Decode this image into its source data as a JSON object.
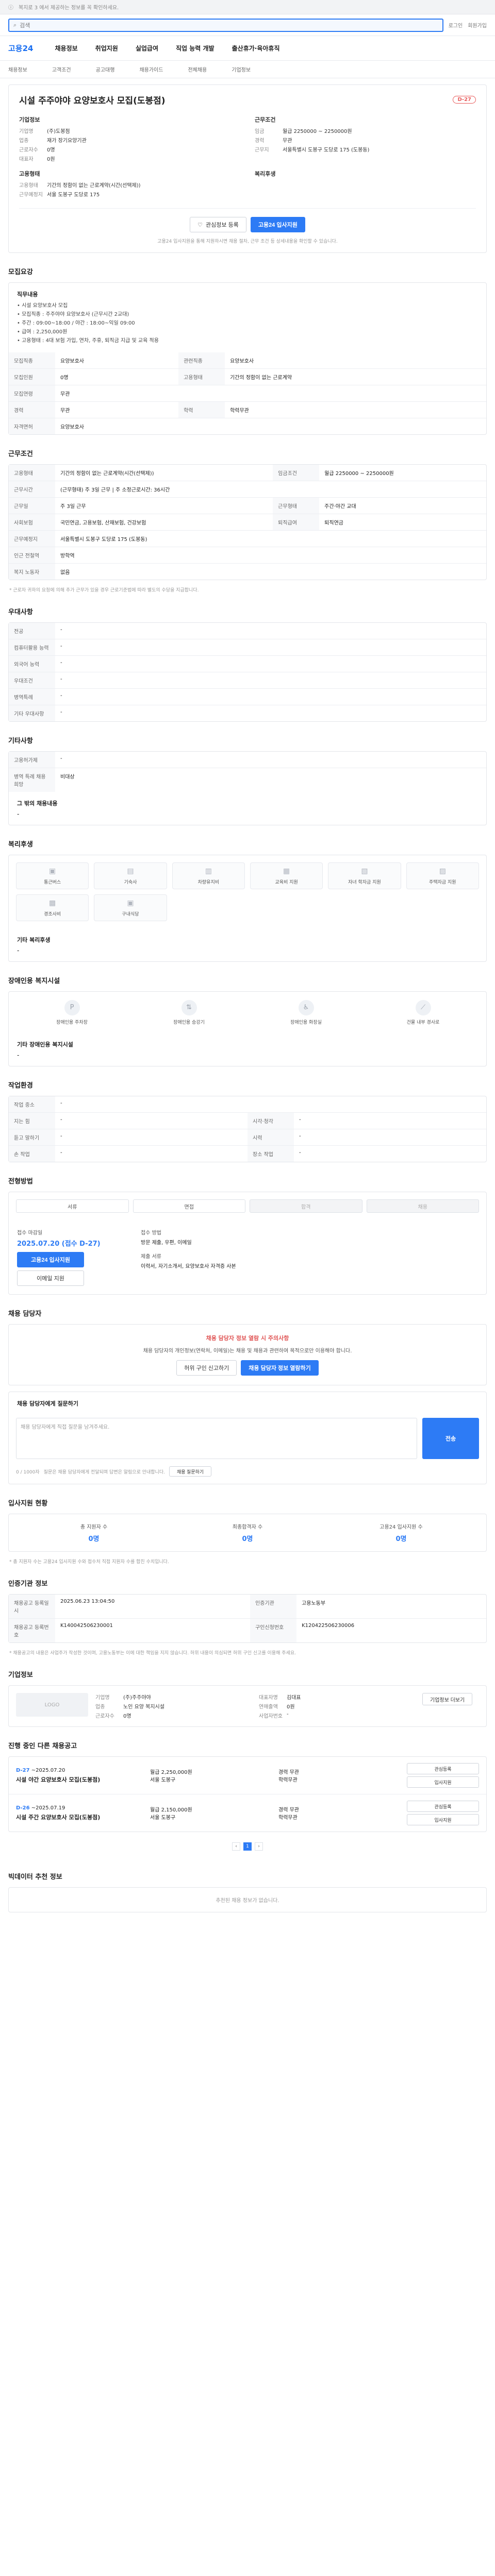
{
  "top_notice": "복지로 3 에서 제공하는 정보를 꼭 확인하세요.",
  "header": {
    "logo": "고용24",
    "search_placeholder": "검색",
    "links": [
      "로그인",
      "회원가입"
    ]
  },
  "gnb": [
    "채용정보",
    "취업지원",
    "실업급여",
    "직업 능력 개발",
    "출산휴가·육아휴직"
  ],
  "subnav": [
    "채용정보",
    "고객조건",
    "공고대행",
    "채용가이드",
    "전체채용",
    "기업정보"
  ],
  "job": {
    "title": "시설 주주야야 요양보호사 모집(도봉점)",
    "dday": "D-27",
    "company_header": "기업정보",
    "company_rows": [
      [
        "기업명",
        "(주)도봉점"
      ],
      [
        "업종",
        "재가 장기요양기관"
      ],
      [
        "근로자수",
        "0명"
      ],
      [
        "대표자",
        "0원"
      ]
    ],
    "cond_header": "근무조건",
    "cond_rows": [
      [
        "임금",
        "월급 2250000 ~ 2250000원"
      ],
      [
        "경력",
        "무관"
      ],
      [
        "근무지",
        "서울특별시 도봉구 도당로 175 (도봉동)"
      ]
    ],
    "manager_header": "고용형태",
    "manager_rows": [
      [
        "고용형태",
        "기간의 정함이 없는 근로계약(시간(선택제))"
      ],
      [
        "근무예정지",
        "서울 도봉구 도당로 175"
      ]
    ],
    "welfare_header": "복리후생",
    "btn_scrap": "관심정보 등록",
    "btn_apply": "고용24 입사지원",
    "hero_note": "고용24 입사지원을 통해 지원하시면 채용 절차, 근무 조건 등 상세내용을 확인할 수 있습니다."
  },
  "detail": {
    "title": "모집요강",
    "duty_header": "직무내용",
    "duty_list": [
      "• 시설 요양보호사 모집",
      "• 모집직종 : 주주야야 요양보호사 (근무시간 2교대)",
      "• 주간 : 09:00~18:00 / 야간 : 18:00~익일 09:00",
      "• 급여 : 2,250,000원",
      "• 고용형태 : 4대 보험 가입, 연차, 주휴, 퇴직금 지급 및 교육 적용"
    ],
    "rows": [
      [
        [
          "모집직종",
          "요양보호사"
        ],
        [
          "관련직종",
          "요양보호사"
        ]
      ],
      [
        [
          "모집인원",
          "0명"
        ],
        [
          "고용형태",
          "기간의 정함이 없는 근로계약"
        ]
      ],
      [
        [
          "모집연령",
          "무관"
        ],
        [
          "",
          ""
        ]
      ],
      [
        [
          "경력",
          "무관"
        ],
        [
          "학력",
          "학력무관"
        ]
      ],
      [
        [
          "자격면허",
          "요양보호사"
        ],
        [
          "",
          ""
        ]
      ]
    ]
  },
  "work": {
    "title": "근무조건",
    "rows": [
      [
        [
          "고용형태",
          "기간의 정함이 없는 근로계약(시간(선택제))"
        ],
        [
          "임금조건",
          "월급 2250000 ~ 2250000원"
        ]
      ],
      [
        [
          "근무시간",
          "(근무형태) 주 3일 근무 | 주 소정근로시간: 36시간"
        ],
        [
          "",
          ""
        ]
      ],
      [
        [
          "근무일",
          "주 3일 근무"
        ],
        [
          "근무형태",
          "주간·야간 교대"
        ]
      ],
      [
        [
          "사회보험",
          "국민연금, 고용보험, 산재보험, 건강보험"
        ],
        [
          "퇴직급여",
          "퇴직연금"
        ]
      ],
      [
        [
          "근무예정지",
          "서울특별시 도봉구 도당로 175 (도봉동)"
        ],
        [
          "",
          ""
        ]
      ],
      [
        [
          "인근 전철역",
          "방학역"
        ],
        [
          "",
          ""
        ]
      ],
      [
        [
          "복지 노동자",
          "없음"
        ],
        [
          "",
          ""
        ]
      ]
    ],
    "footnote": "* 근로자 귀하의 요청에 의해 추가 근무가 있을 경우 근로기준법에 따라 별도의 수당을 지급합니다."
  },
  "pref": {
    "title": "우대사항",
    "rows": [
      [
        "전공",
        "-"
      ],
      [
        "컴퓨터활용 능력",
        "-"
      ],
      [
        "외국어 능력",
        "-"
      ],
      [
        "우대조건",
        "-"
      ],
      [
        "병역특례",
        "-"
      ],
      [
        "기타 우대사항",
        "-"
      ]
    ]
  },
  "etc": {
    "title": "기타사항",
    "rows": [
      [
        "고용허가제",
        "-"
      ],
      [
        "병역 특례 채용희망",
        "비대상"
      ]
    ],
    "extra_label": "그 밖의 채용내용",
    "extra_value": "-"
  },
  "welfare": {
    "title": "복리후생",
    "items": [
      "통근버스",
      "기숙사",
      "차량유지비",
      "교육비 지원",
      "자녀 학자금 지원",
      "주택자금 지원",
      "경조사비",
      "구내식당"
    ],
    "other_label": "기타 복리후생",
    "other_value": "-"
  },
  "disability": {
    "title": "장애인용 복지시설",
    "items": [
      "장애인용 주차장",
      "장애인용 승강기",
      "장애인용 화장실",
      "건물 내부 경사로"
    ],
    "other_label": "기타 장애인용 복지시설",
    "other_value": "-"
  },
  "env": {
    "title": "작업환경",
    "rows": [
      [
        [
          "작업 중소",
          "-"
        ],
        [
          "",
          ""
        ]
      ],
      [
        [
          "지는 힘",
          "-"
        ],
        [
          "시각·청각",
          "-"
        ]
      ],
      [
        [
          "듣고 말하기",
          "-"
        ],
        [
          "시력",
          "-"
        ]
      ],
      [
        [
          "손 작업",
          "-"
        ],
        [
          "장소 작업",
          "-"
        ]
      ]
    ]
  },
  "process": {
    "title": "전형방법",
    "steps": [
      "서류",
      "면접",
      "합격",
      "채용"
    ]
  },
  "apply": {
    "period_label": "접수 마감일",
    "period_value": "2025.07.20 (접수 D-27)",
    "btn_apply": "고용24 입사지원",
    "btn_email": "이메일 지원",
    "method_label": "접수 방법",
    "method_value": "방문 제출, 우편, 이메일",
    "docs_label": "제출 서류",
    "docs_value": "이력서, 자기소개서, 요양보호사 자격증 사본"
  },
  "contact": {
    "title": "채용 담당자",
    "alert_title": "채용 담당자 정보 열람 시 주의사항",
    "alert_body": "채용 담당자의 개인정보(연락처, 이메일)는 채용 및 채용과 관련하여 목적으로만 이용해야 합니다.",
    "btn_view": "채용 담당자 정보 열람하기",
    "btn_report": "허위 구인 신고하기"
  },
  "qna": {
    "title": "채용 담당자에게 질문하기",
    "placeholder": "채용 담당자에게 직접 질문을 남겨주세요.",
    "btn_ask": "전송",
    "counter": "0 / 1000자",
    "notice": "질문은 채용 담당자에게 전달되며 답변은 알림으로 안내합니다.",
    "btn_list": "채용 질문하기"
  },
  "stats": {
    "title": "입사지원 현황",
    "items": [
      [
        "총 지원자 수",
        "0명"
      ],
      [
        "최종합격자 수",
        "0명"
      ],
      [
        "고용24 입사지원 수",
        "0명"
      ]
    ],
    "note": "* 총 지원자 수는 고용24 입사지원 수와 접수처 직접 지원자 수를 합친 수치입니다."
  },
  "meta": {
    "title": "인증기관 정보",
    "rows": [
      [
        [
          "채용공고 등록일시",
          "2025.06.23 13:04:50"
        ],
        [
          "인증기관",
          "고용노동부"
        ]
      ],
      [
        [
          "채용공고 등록번호",
          "K140042506230001"
        ],
        [
          "구인신청번호",
          "K120422506230006"
        ]
      ]
    ],
    "footnote": "* 채용공고의 내용은 사업주가 작성한 것이며, 고용노동부는 이에 대한 책임을 지지 않습니다. 허위 내용이 의심되면 허위 구인 신고를 이용해 주세요."
  },
  "company": {
    "title": "기업정보",
    "logo": "LOGO",
    "rows1": [
      [
        "기업명",
        "(주)주주야야"
      ],
      [
        "업종",
        "노인 요양 복지시설"
      ],
      [
        "근로자수",
        "0명"
      ]
    ],
    "rows2": [
      [
        "대표자명",
        "김대표"
      ],
      [
        "연매출액",
        "0원"
      ],
      [
        "사업자번호",
        "-"
      ]
    ],
    "btn_detail": "기업정보 더보기"
  },
  "others": {
    "title": "진행 중인 다른 채용공고",
    "jobs": [
      {
        "dday": "D-27",
        "date": "~2025.07.20",
        "title": "시설 야간 요양보호사 모집(도봉점)",
        "cond1": "월급 2,250,000원",
        "cond2": "서울 도봉구",
        "cond3": "경력 무관",
        "cond4": "학력무관"
      },
      {
        "dday": "D-26",
        "date": "~2025.07.19",
        "title": "시설 주간 요양보호사 모집(도봉점)",
        "cond1": "월급 2,150,000원",
        "cond2": "서울 도봉구",
        "cond3": "경력 무관",
        "cond4": "학력무관"
      }
    ],
    "btn_scrap": "관심등록",
    "btn_apply": "입사지원",
    "pages": [
      "1"
    ]
  },
  "recommend": {
    "title": "빅데이터 추천 정보",
    "empty": "추천된 채용 정보가 없습니다."
  }
}
